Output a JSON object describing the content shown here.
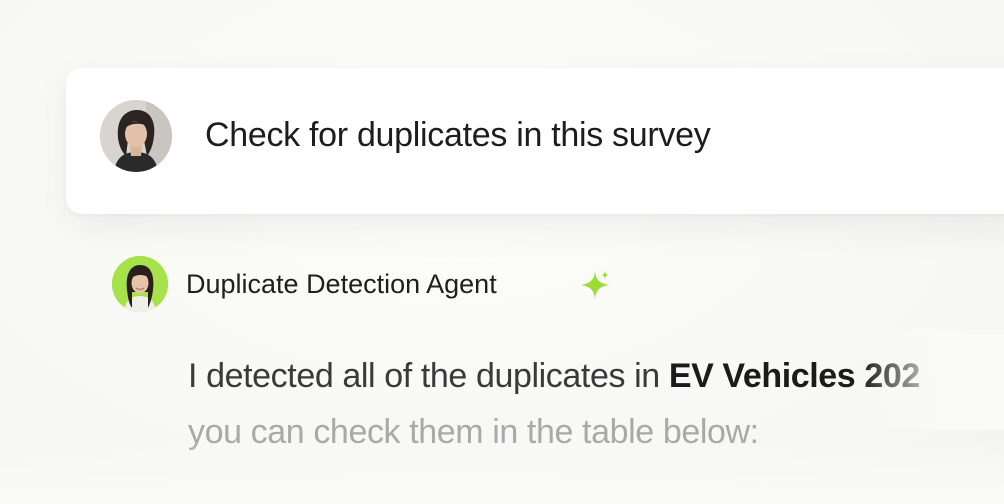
{
  "user_message": {
    "text": "Check for duplicates in this survey",
    "avatar_icon": "user-avatar"
  },
  "agent": {
    "name": "Duplicate Detection Agent",
    "badge_icon": "sparkle-icon",
    "avatar_icon": "agent-avatar",
    "accent_color": "#a6e24a"
  },
  "reply": {
    "prefix": "I detected all of the duplicates in ",
    "highlight": "EV Vehicles 202",
    "line2": "you can check them in the table below:"
  }
}
